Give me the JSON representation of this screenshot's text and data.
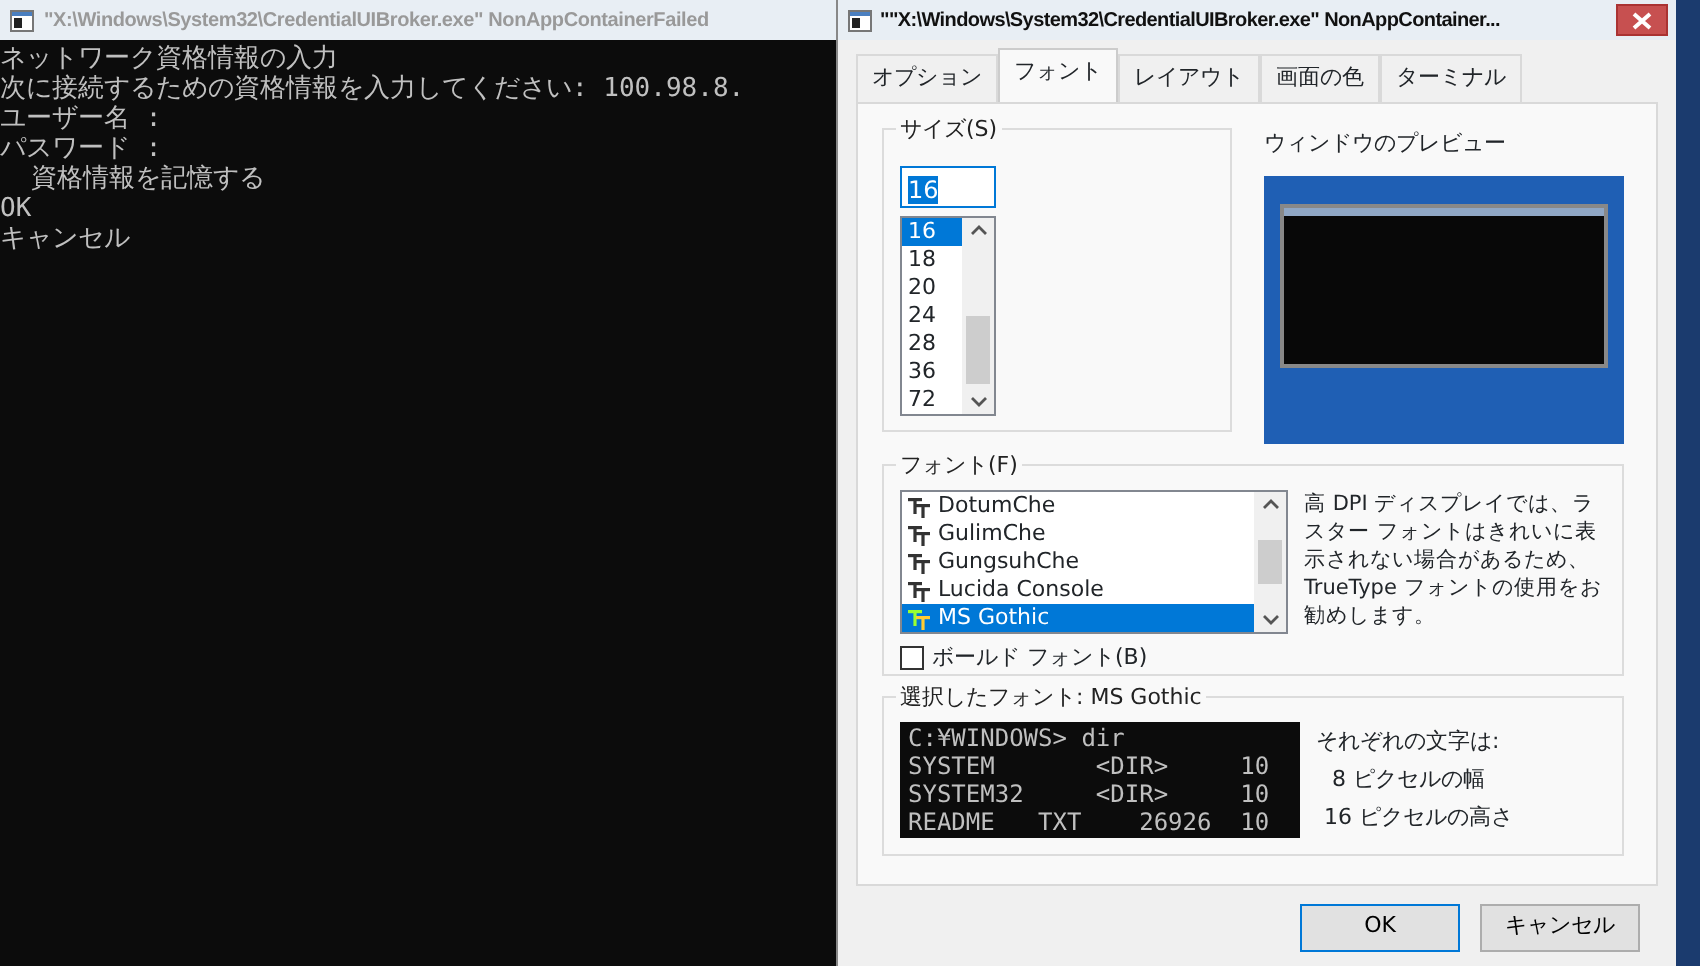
{
  "console": {
    "title": "\"X:\\Windows\\System32\\CredentialUIBroker.exe\" NonAppContainerFailed",
    "lines": [
      "ネットワーク資格情報の入力",
      "次に接続するための資格情報を入力してください: 100.98.8.",
      "ユーザー名 :",
      "パスワード :",
      "  資格情報を記憶する",
      "OK",
      "キャンセル"
    ]
  },
  "dialog": {
    "title": "\"\"X:\\Windows\\System32\\CredentialUIBroker.exe\" NonAppContainer...",
    "tabs": [
      {
        "label": "オプション",
        "selected": false
      },
      {
        "label": "フォント",
        "selected": true
      },
      {
        "label": "レイアウト",
        "selected": false
      },
      {
        "label": "画面の色",
        "selected": false
      },
      {
        "label": "ターミナル",
        "selected": false
      }
    ],
    "size": {
      "label": "サイズ(S)",
      "value": "16",
      "items": [
        {
          "label": "16",
          "selected": true
        },
        {
          "label": "18",
          "selected": false
        },
        {
          "label": "20",
          "selected": false
        },
        {
          "label": "24",
          "selected": false
        },
        {
          "label": "28",
          "selected": false
        },
        {
          "label": "36",
          "selected": false
        },
        {
          "label": "72",
          "selected": false
        }
      ]
    },
    "preview": {
      "label": "ウィンドウのプレビュー"
    },
    "font": {
      "label": "フォント(F)",
      "items": [
        {
          "label": "DotumChe",
          "selected": false
        },
        {
          "label": "GulimChe",
          "selected": false
        },
        {
          "label": "GungsuhChe",
          "selected": false
        },
        {
          "label": "Lucida Console",
          "selected": false
        },
        {
          "label": "MS Gothic",
          "selected": true
        }
      ],
      "bold": {
        "label": "ボールド フォント(B)",
        "checked": false
      },
      "note": "高 DPI ディスプレイでは、ラスター フォントはきれいに表示されない場合があるため、TrueType フォントの使用をお勧めします。"
    },
    "selected_font": {
      "label": "選択したフォント: MS Gothic",
      "sample_lines": [
        "C:¥WINDOWS> dir",
        "SYSTEM       <DIR>     10",
        "SYSTEM32     <DIR>     10",
        "README   TXT    26926  10"
      ],
      "info_label": "それぞれの文字は:",
      "width_text": "8 ピクセルの幅",
      "height_text": "16 ピクセルの高さ"
    },
    "buttons": [
      {
        "label": "OK",
        "default": true
      },
      {
        "label": "キャンセル",
        "default": false
      }
    ]
  }
}
